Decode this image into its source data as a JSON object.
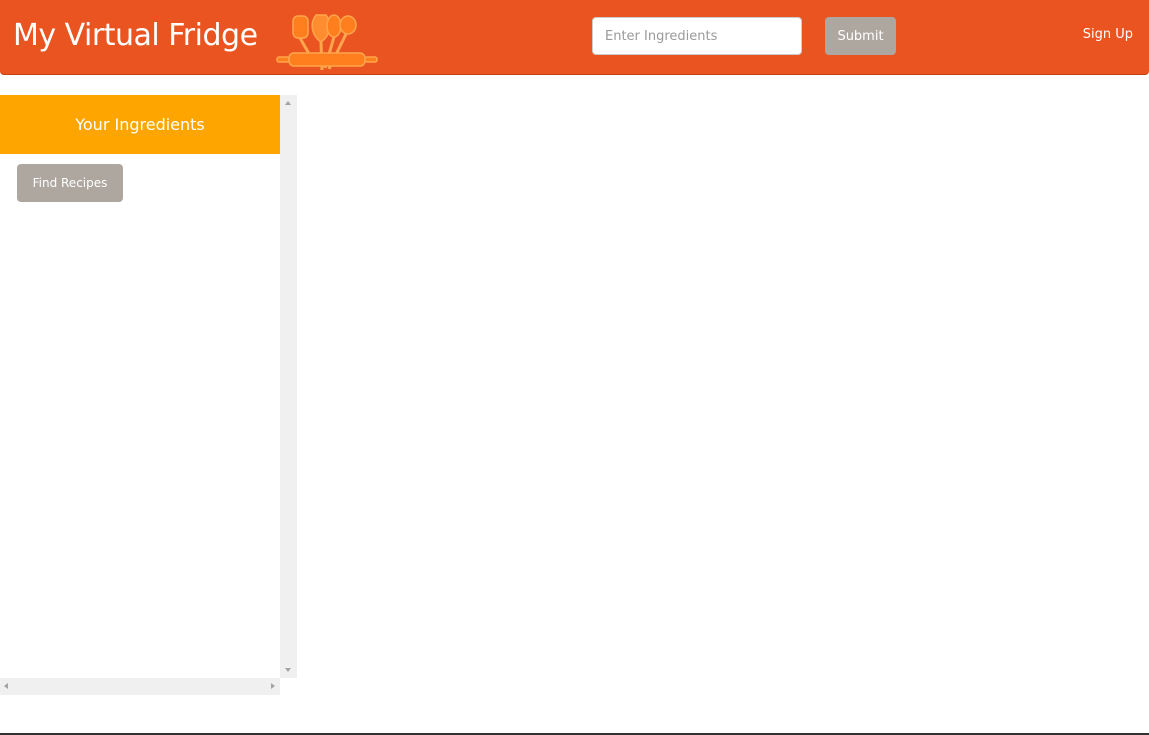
{
  "navbar": {
    "brand": "My Virtual Fridge",
    "logo_icon": "kitchen-utensils-icon",
    "search": {
      "placeholder": "Enter Ingredients",
      "value": ""
    },
    "submit_label": "Submit",
    "signup_label": "Sign Up"
  },
  "sidebar": {
    "title": "Your Ingredients",
    "find_recipes_label": "Find Recipes"
  },
  "colors": {
    "navbar": "#e95420",
    "panel_header": "#ffa500",
    "button": "#aea79f",
    "logo": "#ff7f1e"
  }
}
